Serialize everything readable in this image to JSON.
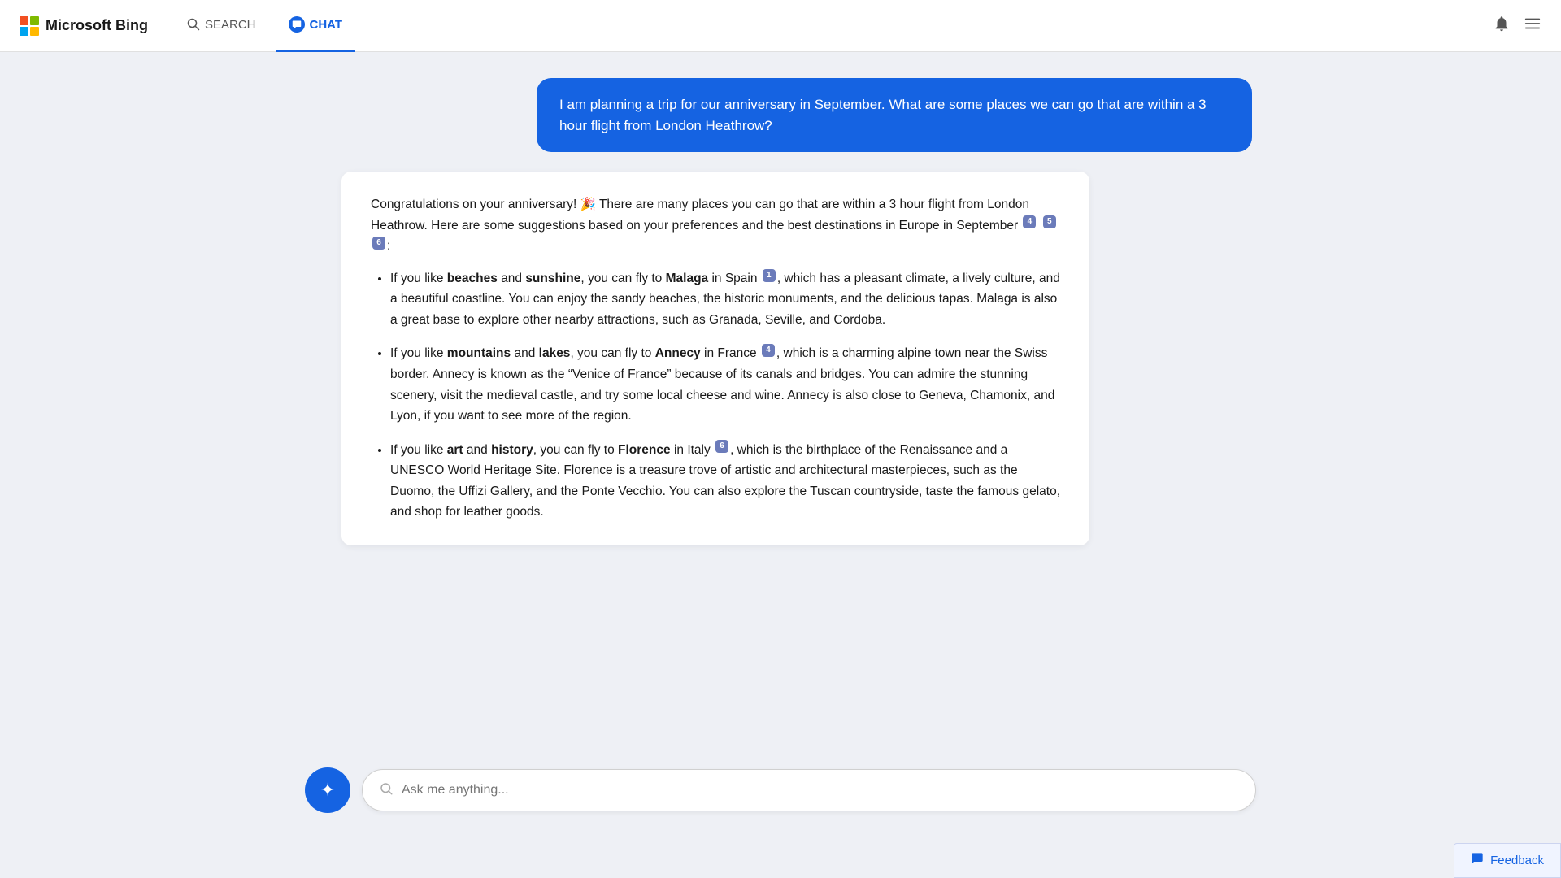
{
  "navbar": {
    "logo_text": "Microsoft Bing",
    "nav_search_label": "SEARCH",
    "nav_chat_label": "CHAT",
    "active_tab": "chat"
  },
  "user_message": {
    "text": "I am planning a trip for our anniversary in September. What are some places we can go that are within a 3 hour flight from London Heathrow?"
  },
  "response": {
    "intro": "Congratulations on your anniversary! 🎉 There are many places you can go that are within a 3 hour flight from London Heathrow. Here are some suggestions based on your preferences and the best destinations in Europe in September",
    "citations_intro": [
      "4",
      "5",
      "6"
    ],
    "items": [
      {
        "prefix": "If you like ",
        "bold1": "beaches",
        "mid1": " and ",
        "bold2": "sunshine",
        "mid2": ", you can fly to ",
        "bold3": "Malaga",
        "mid3": " in Spain",
        "citation": "1",
        "rest": ", which has a pleasant climate, a lively culture, and a beautiful coastline. You can enjoy the sandy beaches, the historic monuments, and the delicious tapas. Malaga is also a great base to explore other nearby attractions, such as Granada, Seville, and Cordoba."
      },
      {
        "prefix": "If you like ",
        "bold1": "mountains",
        "mid1": " and ",
        "bold2": "lakes",
        "mid2": ", you can fly to ",
        "bold3": "Annecy",
        "mid3": " in France",
        "citation": "4",
        "rest": ", which is a charming alpine town near the Swiss border. Annecy is known as the “Venice of France” because of its canals and bridges. You can admire the stunning scenery, visit the medieval castle, and try some local cheese and wine. Annecy is also close to Geneva, Chamonix, and Lyon, if you want to see more of the region."
      },
      {
        "prefix": "If you like ",
        "bold1": "art",
        "mid1": " and ",
        "bold2": "history",
        "mid2": ", you can fly to ",
        "bold3": "Florence",
        "mid3": " in Italy",
        "citation": "6",
        "rest": ", which is the birthplace of the Renaissance and a UNESCO World Heritage Site. Florence is a treasure trove of artistic and architectural masterpieces, such as the Duomo, the Uffizi Gallery, and the Ponte Vecchio. You can also explore the Tuscan countryside, taste the famous gelato, and shop for leather goods."
      }
    ]
  },
  "input": {
    "placeholder": "Ask me anything..."
  },
  "feedback": {
    "label": "Feedback"
  }
}
